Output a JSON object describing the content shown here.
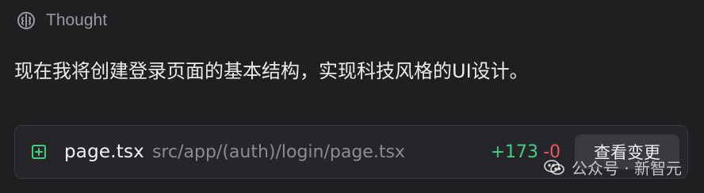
{
  "thought": {
    "label": "Thought",
    "icon": "brain-icon"
  },
  "message": {
    "text": "现在我将创建登录页面的基本结构，实现科技风格的UI设计。"
  },
  "file_change": {
    "icon": "plus-square-icon",
    "file_name": "page.tsx",
    "file_path": "src/app/(auth)/login/page.tsx",
    "additions": "+173",
    "deletions": "-0",
    "view_button_label": "查看变更"
  },
  "watermark": {
    "text": "公众号 · 新智元",
    "icon": "wechat-icon"
  },
  "colors": {
    "background": "#1f1f21",
    "card": "#26262a",
    "added": "#3fd07f",
    "deleted": "#e65b5b",
    "accent_icon": "#3fd07f"
  }
}
